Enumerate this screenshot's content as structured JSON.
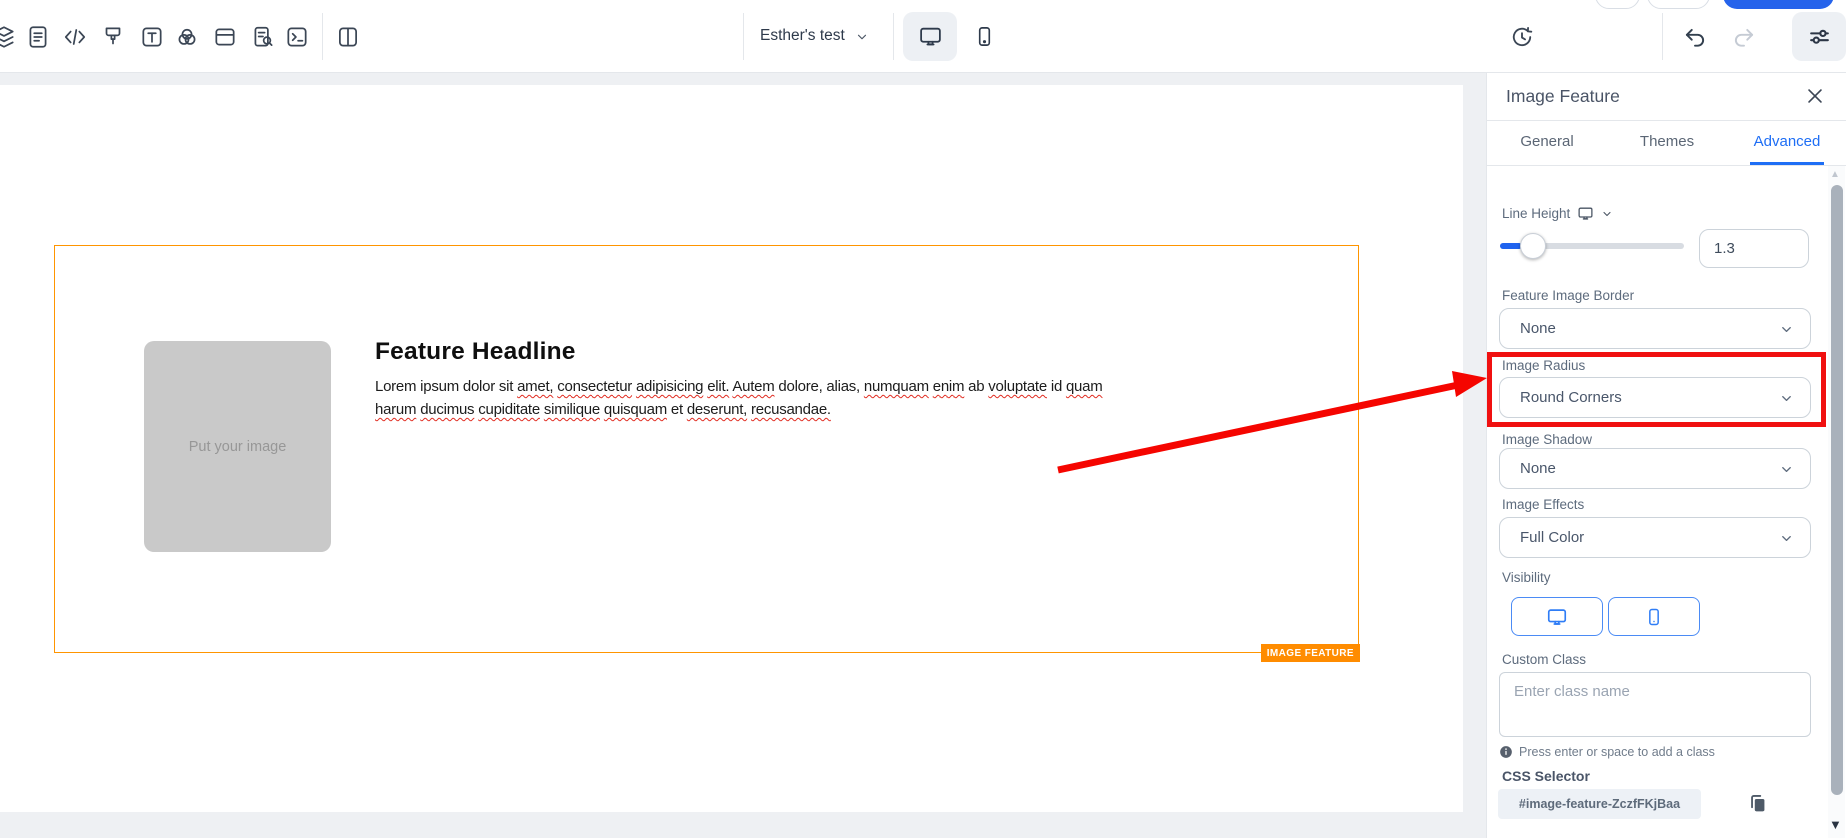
{
  "colors": {
    "accent_blue": "#2563eb",
    "selection_orange": "#ff9500",
    "tag_orange": "#ff8c00",
    "annotation_red": "#f01010"
  },
  "top_bar": {
    "document_name": "Esther's test",
    "left_icons": [
      "layers",
      "notes",
      "code",
      "brush",
      "text",
      "shapes",
      "rows",
      "page-search",
      "terminal",
      "columns"
    ],
    "device_toggle": [
      "desktop",
      "mobile"
    ],
    "right_icons": [
      "history",
      "undo",
      "redo",
      "settings"
    ]
  },
  "canvas": {
    "block_tag": "IMAGE FEATURE",
    "image_placeholder_text": "Put your image",
    "headline": "Feature Headline",
    "paragraph_line1": [
      [
        "Lorem ipsum dolor sit ",
        0
      ],
      [
        "amet,",
        1
      ],
      [
        " ",
        0
      ],
      [
        "consectetur",
        1
      ],
      [
        " ",
        0
      ],
      [
        "adipisicing",
        1
      ],
      [
        " ",
        0
      ],
      [
        "elit.",
        1
      ],
      [
        " ",
        0
      ],
      [
        "Autem",
        1
      ],
      [
        " dolore, alias, ",
        0
      ],
      [
        "numquam",
        1
      ],
      [
        " ",
        0
      ],
      [
        "enim",
        1
      ],
      [
        " ab ",
        0
      ],
      [
        "voluptate",
        1
      ],
      [
        " id ",
        0
      ],
      [
        "quam",
        1
      ]
    ],
    "paragraph_line2": [
      [
        "harum",
        1
      ],
      [
        " ",
        0
      ],
      [
        "ducimus",
        1
      ],
      [
        " ",
        0
      ],
      [
        "cupiditate",
        1
      ],
      [
        " ",
        0
      ],
      [
        "similique",
        1
      ],
      [
        " ",
        0
      ],
      [
        "quisquam",
        1
      ],
      [
        " et ",
        0
      ],
      [
        "deserunt,",
        1
      ],
      [
        " ",
        0
      ],
      [
        "recusandae.",
        1
      ]
    ]
  },
  "panel": {
    "title": "Image Feature",
    "tabs": [
      {
        "label": "General",
        "active": false
      },
      {
        "label": "Themes",
        "active": false
      },
      {
        "label": "Advanced",
        "active": true
      }
    ],
    "line_height": {
      "label": "Line Height",
      "value": "1.3"
    },
    "fields": [
      {
        "label": "Feature Image Border",
        "value": "None"
      },
      {
        "label": "Image Radius",
        "value": "Round Corners"
      },
      {
        "label": "Image Shadow",
        "value": "None"
      },
      {
        "label": "Image Effects",
        "value": "Full Color"
      }
    ],
    "visibility": {
      "label": "Visibility"
    },
    "custom_class": {
      "label": "Custom Class",
      "placeholder": "Enter class name",
      "hint": "Press enter or space to add a class"
    },
    "css_selector": {
      "label": "CSS Selector",
      "value": "#image-feature-ZczfFKjBaa"
    }
  }
}
